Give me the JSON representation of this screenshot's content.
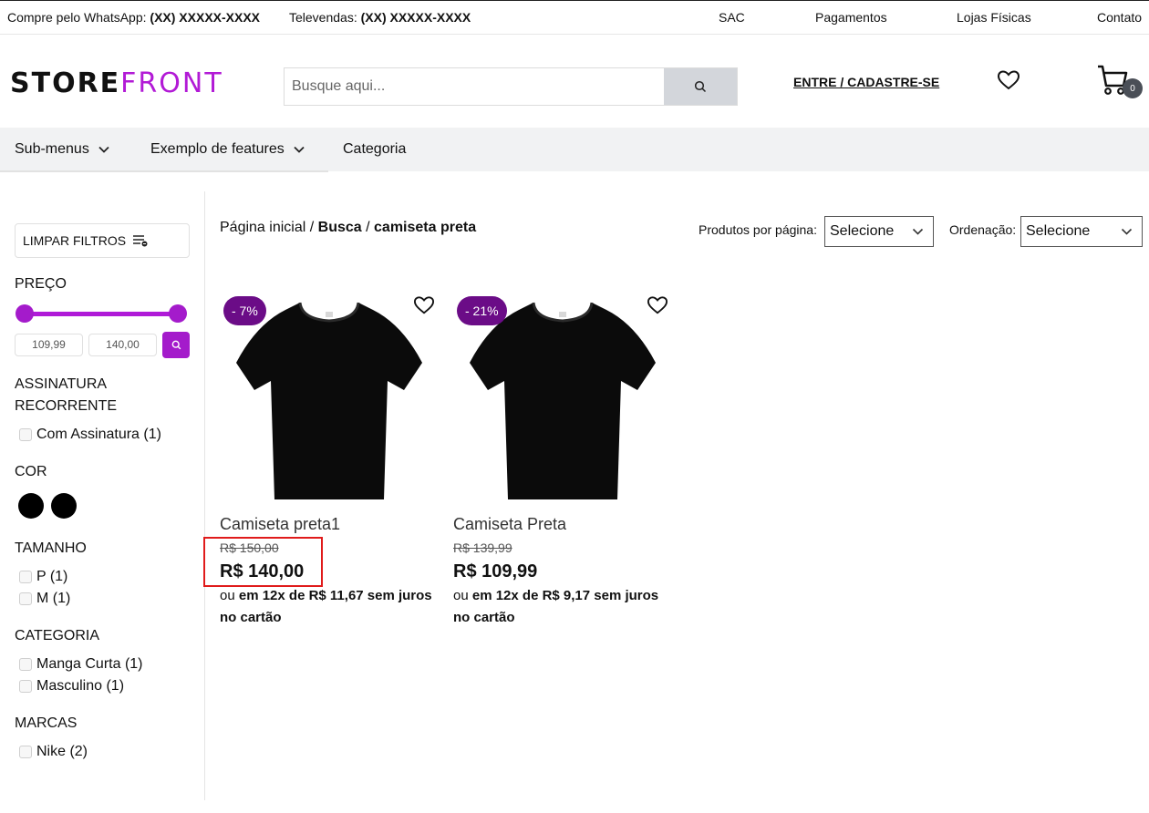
{
  "topbar": {
    "whatsapp_label": "Compre pelo WhatsApp:",
    "whatsapp_number": "(XX) XXXXX-XXXX",
    "televendas_label": "Televendas:",
    "televendas_number": "(XX) XXXXX-XXXX",
    "links": [
      "SAC",
      "Pagamentos",
      "Lojas Físicas",
      "Contato"
    ]
  },
  "header": {
    "logo_part1": "STORE",
    "logo_part2": "FRONT",
    "search_placeholder": "Busque aqui...",
    "login_label": "ENTRE / CADASTRE-SE",
    "cart_count": "0",
    "icons": [
      "search-icon",
      "heart-icon",
      "cart-icon"
    ]
  },
  "nav": {
    "items": [
      "Sub-menus",
      "Exemplo de features",
      "Categoria"
    ]
  },
  "filters": {
    "clear_label": "LIMPAR FILTROS",
    "price_title": "PREÇO",
    "price_min": "109,99",
    "price_max": "140,00",
    "subscription_title_1": "ASSINATURA",
    "subscription_title_2": "RECORRENTE",
    "subscription_option": "Com Assinatura (1)",
    "color_title": "COR",
    "size_title": "TAMANHO",
    "size_options": [
      "P (1)",
      "M (1)"
    ],
    "category_title": "CATEGORIA",
    "category_options": [
      "Manga Curta (1)",
      "Masculino (1)"
    ],
    "brand_title": "MARCAS",
    "brand_options": [
      "Nike (2)"
    ]
  },
  "breadcrumb": {
    "home": "Página inicial",
    "sep": "/",
    "search": "Busca",
    "term": "camiseta preta"
  },
  "toolbar": {
    "per_page_label": "Produtos por página:",
    "per_page_value": "Selecione",
    "sort_label": "Ordenação:",
    "sort_value": "Selecione"
  },
  "products": [
    {
      "name": "Camiseta preta1",
      "discount": "- 7%",
      "old_price": "R$ 150,00",
      "price": "R$ 140,00",
      "inst_ou": "ou",
      "installments": "em 12x de R$ 11,67 sem juros no cartão"
    },
    {
      "name": "Camiseta Preta",
      "discount": "- 21%",
      "old_price": "R$ 139,99",
      "price": "R$ 109,99",
      "inst_ou": "ou",
      "installments": "em 12x de R$ 9,17 sem juros no cartão"
    }
  ],
  "colors": {
    "accent": "#a41bcb",
    "discount_badge": "#6b0c87",
    "highlight": "#e01b1b"
  }
}
